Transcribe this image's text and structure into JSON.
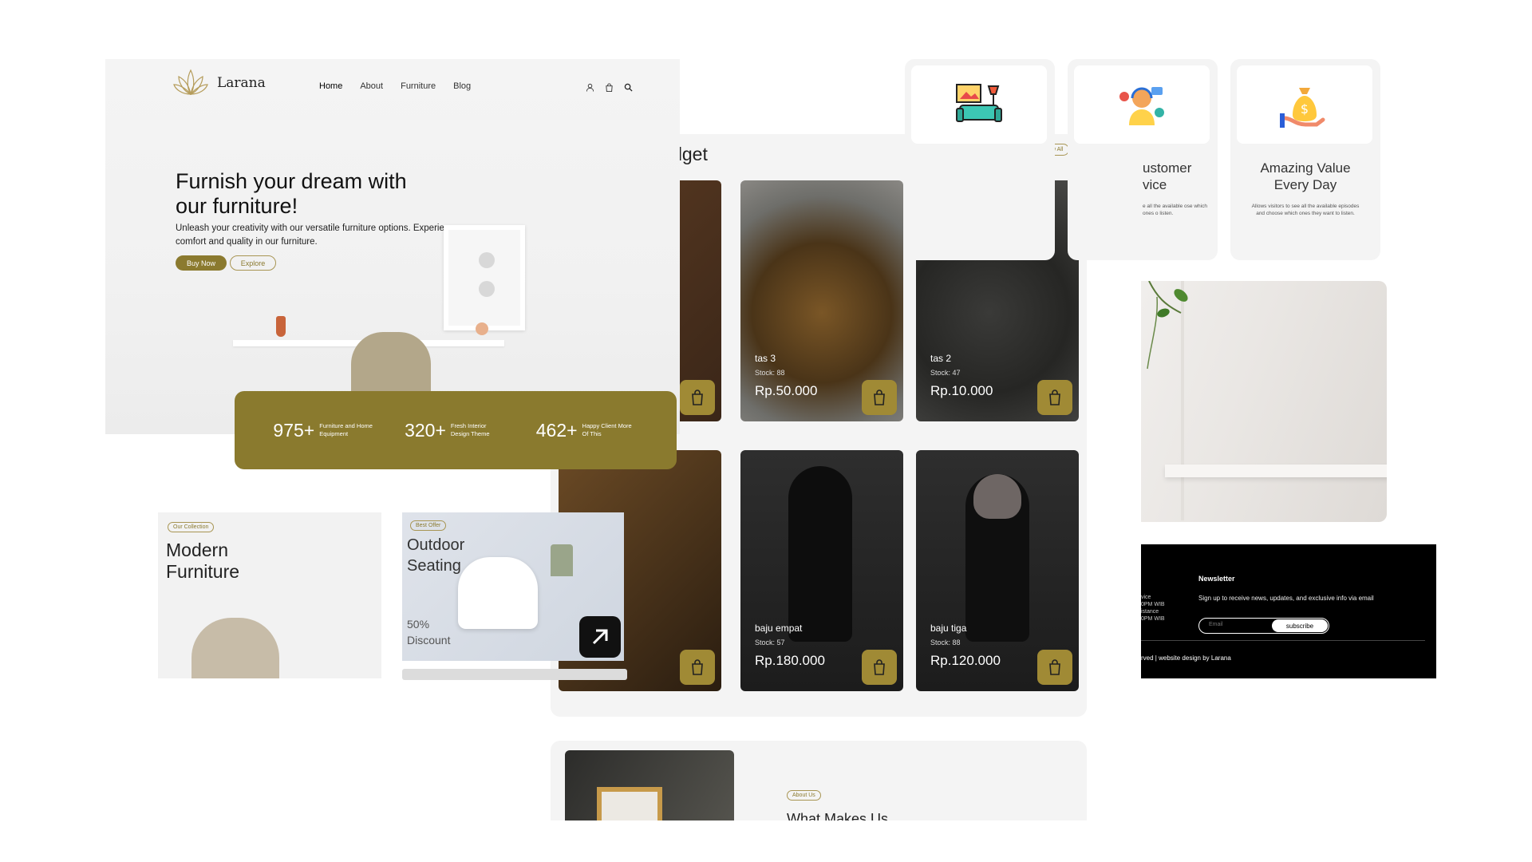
{
  "hero": {
    "brand": "Larana",
    "nav": [
      "Home",
      "About",
      "Furniture",
      "Blog"
    ],
    "title": "Furnish your dream with our furniture!",
    "subtitle": "Unleash your creativity with our versatile furniture options. Experience comfort and quality in our furniture.",
    "buy_label": "Buy Now",
    "explore_label": "Explore",
    "icons": [
      "user-icon",
      "bag-icon",
      "search-icon"
    ]
  },
  "stats": [
    {
      "value": "975+",
      "label": "Furniture and Home Equipment"
    },
    {
      "value": "320+",
      "label": "Fresh Interior Design Theme"
    },
    {
      "value": "462+",
      "label": "Happy Client More Of This"
    }
  ],
  "collection": {
    "pill": "Our Collection",
    "title": "Modern Furniture"
  },
  "outdoor": {
    "pill": "Best Offer",
    "title": "Outdoor Seating",
    "discount": "50% Discount"
  },
  "products": {
    "title": "gn for Any Budget",
    "view_all": "View All",
    "items": [
      {
        "name": "tas 3",
        "stock": "Stock: 88",
        "price": "Rp.50.000"
      },
      {
        "name": "tas 2",
        "stock": "Stock: 47",
        "price": "Rp.10.000"
      },
      {
        "name": "baju empat",
        "stock": "Stock: 57",
        "price": "Rp.180.000"
      },
      {
        "name": "baju tiga",
        "stock": "Stock: 88",
        "price": "Rp.120.000"
      }
    ]
  },
  "features": [
    {
      "title": "",
      "desc": "",
      "icon": "sofa-icon"
    },
    {
      "title": "ustomer vice",
      "desc": "e all the available ose which ones o listen.",
      "icon": "support-icon"
    },
    {
      "title": "Amazing Value Every Day",
      "desc": "Allows visitors to see all the available episodes and choose which ones they want to listen.",
      "icon": "money-bag-icon"
    }
  ],
  "footer": {
    "newsletter_title": "Newsletter",
    "newsletter_text": "Sign up to receive news, updates, and exclusive info via email",
    "email_placeholder": "Email",
    "subscribe_label": "subscribe",
    "links": [
      "vice",
      "0PM WIB",
      "istance",
      "0PM WIB"
    ],
    "copyright": "rved | website design by Larana"
  },
  "about": {
    "pill": "About Us",
    "title": "What Makes Us"
  },
  "colors": {
    "accent": "#8a7a2e",
    "accent_light": "#a08a35",
    "dark": "#000000"
  }
}
